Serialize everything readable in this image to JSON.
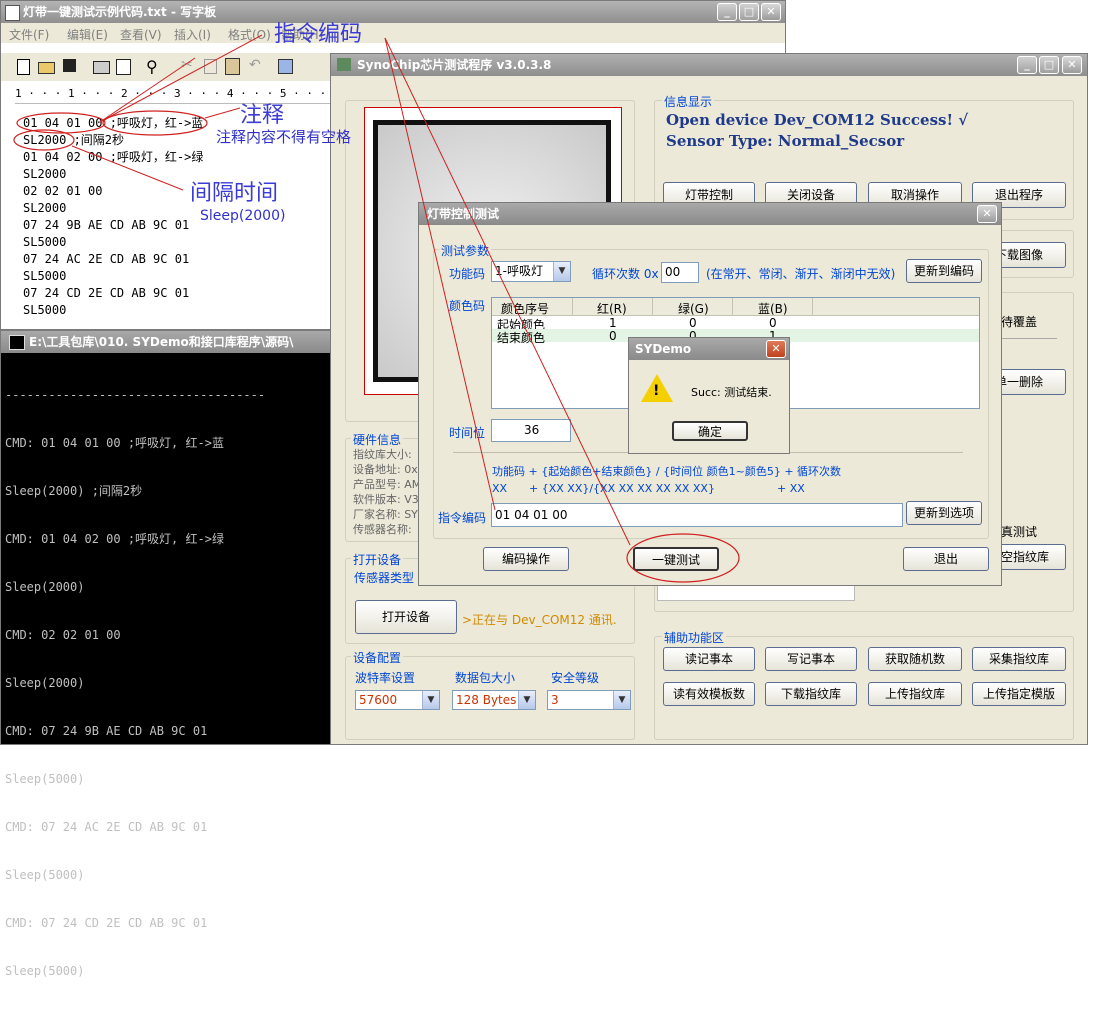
{
  "notepad": {
    "title": "灯带一键测试示例代码.txt - 写字板",
    "menu": [
      "文件(F)",
      "编辑(E)",
      "查看(V)",
      "插入(I)",
      "格式(O)",
      "帮助(H)"
    ],
    "ruler": "1 · · · 1 · · · 2 · · · 3 · · · 4 · · · 5 · · · 6 · · · 7 · · · 8",
    "lines": [
      "01 04 01 00 ;呼吸灯，红->蓝",
      "SL2000 ;间隔2秒",
      "01 04 02 00 ;呼吸灯，红->绿",
      "SL2000",
      "02 02 01 00",
      "SL2000",
      "07 24 9B AE CD AB 9C 01",
      "SL5000",
      "07 24 AC 2E CD AB 9C 01",
      "SL5000",
      "07 24 CD 2E CD AB 9C 01",
      "SL5000"
    ]
  },
  "annotations": {
    "cmd_code": "指令编码",
    "comment": "注释",
    "comment_note": "注释内容不得有空格",
    "interval": "间隔时间",
    "sleep": "Sleep(2000)"
  },
  "console": {
    "title": "E:\\工具包库\\010. SYDemo和接口库程序\\源码\\",
    "separator": "------------------------------------",
    "lines": [
      "CMD: 01 04 01 00 ;呼吸灯, 红->蓝",
      "Sleep(2000) ;间隔2秒",
      "CMD: 01 04 02 00 ;呼吸灯, 红->绿",
      "Sleep(2000)",
      "CMD: 02 02 01 00",
      "Sleep(2000)",
      "CMD: 07 24 9B AE CD AB 9C 01",
      "Sleep(5000)",
      "CMD: 07 24 AC 2E CD AB 9C 01",
      "Sleep(5000)",
      "CMD: 07 24 CD 2E CD AB 9C 01",
      "Sleep(5000)"
    ]
  },
  "main": {
    "title": "SynoChip芯片测试程序 v3.0.3.8",
    "info_label": "信息显示",
    "info_line1": "Open device Dev_COM12 Success! √",
    "info_line2": "Sensor Type: Normal_Secsor",
    "buttons_top": [
      "灯带控制",
      "关闭设备",
      "取消操作",
      "退出程序"
    ],
    "btn_download_image": "下载图像",
    "lbl_overwrite": "待覆盖",
    "btn_delete_one": "单一删除",
    "lbl_true_test": "真测试",
    "btn_clear_lib": "清空指纹库",
    "hw_label": "硬件信息",
    "hw_lines": [
      "指纹库大小:",
      "设备地址: 0x",
      "产品型号: AM",
      "软件版本: V3",
      "厂家名称: SY",
      "传感器名称:"
    ],
    "open_dev_label": "打开设备",
    "sensor_type_label": "传感器类型",
    "btn_open_device": "打开设备",
    "status_text": ">正在与 Dev_COM12 通讯.",
    "dev_cfg_label": "设备配置",
    "baud_label": "波特率设置",
    "baud_value": "57600",
    "pkt_label": "数据包大小",
    "pkt_value": "128 Bytes",
    "sec_label": "安全等级",
    "sec_value": "3",
    "aux_label": "辅助功能区",
    "aux_row1": [
      "读记事本",
      "写记事本",
      "获取随机数",
      "采集指纹库"
    ],
    "aux_row2": [
      "读有效模板数",
      "下载指纹库",
      "上传指纹库",
      "上传指定模版"
    ]
  },
  "dialog": {
    "title": "灯带控制测试",
    "group_label": "测试参数",
    "func_label": "功能码",
    "func_value": "1-呼吸灯",
    "loop_label": "循环次数 0x",
    "loop_value": "00",
    "loop_note": "(在常开、常闭、渐开、渐闭中无效)",
    "btn_update_code": "更新到编码",
    "color_label": "颜色码",
    "table_headers": [
      "颜色序号",
      "红(R)",
      "绿(G)",
      "蓝(B)"
    ],
    "table_rows": [
      [
        "起始颜色",
        "1",
        "0",
        "0"
      ],
      [
        "结束颜色",
        "0",
        "0",
        "1"
      ]
    ],
    "time_label": "时间位",
    "time_value": "36",
    "formula1": "功能码 + {起始颜色+结束颜色} / {时间位 颜色1~颜色5} + 循环次数",
    "formula2_a": "XX",
    "formula2_b": "+ {XX XX}/{XX XX XX XX XX XX}",
    "formula2_c": "+ XX",
    "cmd_label": "指令编码",
    "cmd_value": "01 04 01 00",
    "btn_update_option": "更新到选项",
    "btn_encode": "编码操作",
    "btn_one_key": "一键测试",
    "btn_exit": "退出"
  },
  "msgbox": {
    "title": "SYDemo",
    "message": "Succ: 测试结束.",
    "ok": "确定"
  }
}
